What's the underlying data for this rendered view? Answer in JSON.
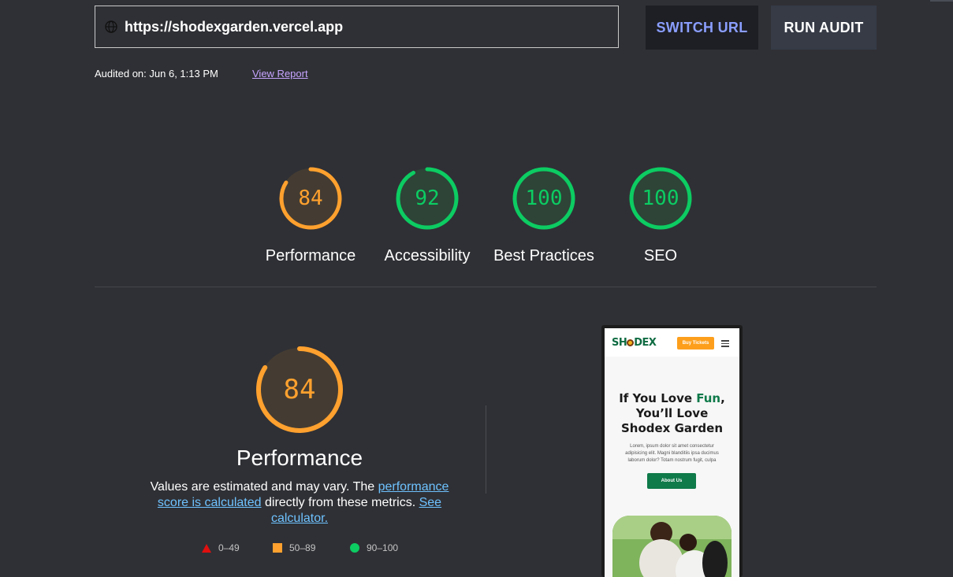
{
  "header": {
    "url": "https://shodexgarden.vercel.app",
    "switch_url_label": "SWITCH URL",
    "run_audit_label": "RUN AUDIT",
    "audited_on": "Audited on: Jun 6, 1:13 PM",
    "view_report": "View Report"
  },
  "categories": [
    {
      "label": "Performance",
      "score": "84",
      "status": "average"
    },
    {
      "label": "Accessibility",
      "score": "92",
      "status": "pass"
    },
    {
      "label": "Best Practices",
      "score": "100",
      "status": "pass"
    },
    {
      "label": "SEO",
      "score": "100",
      "status": "pass"
    }
  ],
  "performance": {
    "score": "84",
    "title": "Performance",
    "desc_1": "Values are estimated and may vary. The ",
    "desc_link_1": "performance score is calculated",
    "desc_2": " directly from these metrics. ",
    "desc_link_2": "See calculator."
  },
  "legend": [
    {
      "range": "0–49",
      "shape": "triangle",
      "color": "#e00f0f"
    },
    {
      "range": "50–89",
      "shape": "square",
      "color": "#ffa12e"
    },
    {
      "range": "90–100",
      "shape": "circle",
      "color": "#0ccc62"
    }
  ],
  "screenshot": {
    "logo": "SHODEX",
    "buy_button": "Buy Tickets",
    "headline_1": "If You Love ",
    "headline_fun": "Fun",
    "headline_2": ",",
    "headline_3": "You’ll Love",
    "headline_4": "Shodex Garden",
    "paragraph": "Lorem, ipsum dolor sit amet consectetur adipisicing elit. Magni blanditiis ipsa ducimus laborum dolor? Totam nostrum fugit, culpa",
    "about_button": "About Us"
  },
  "colors": {
    "background": "#2f3035",
    "average": "#ffa12e",
    "pass": "#0ccc62",
    "fail": "#e00f0f",
    "link": "#6ec2ff"
  }
}
